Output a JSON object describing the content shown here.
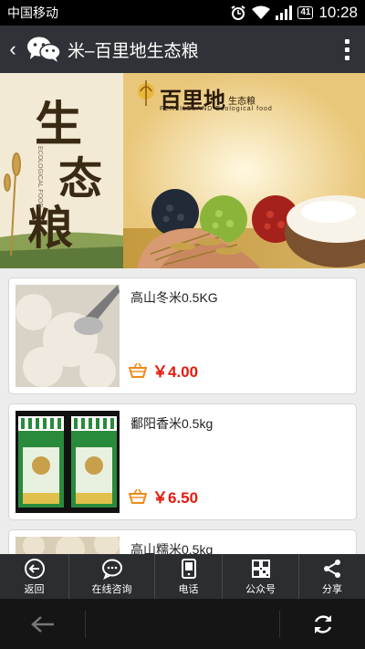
{
  "status_bar": {
    "carrier": "中国移动",
    "battery": "41",
    "time": "10:28"
  },
  "header": {
    "title": "米–百里地生态粮"
  },
  "banner": {
    "brand": "百里地",
    "brand_sub": "生态粮",
    "brand_en": "FERTILELAND Ecological food",
    "calligraphy": [
      "生",
      "态",
      "粮"
    ],
    "vertical_text": "ECOLOGICAL FOOD"
  },
  "products": [
    {
      "name": "高山冬米0.5KG",
      "price": "￥4.00"
    },
    {
      "name": "鄱阳香米0.5kg",
      "price": "￥6.50"
    },
    {
      "name": "高山糯米0.5kg",
      "price": ""
    }
  ],
  "menu": [
    {
      "label": "返回",
      "icon": "back-circle-icon"
    },
    {
      "label": "在线咨询",
      "icon": "chat-bubble-icon"
    },
    {
      "label": "电话",
      "icon": "phone-icon"
    },
    {
      "label": "公众号",
      "icon": "qrcode-icon"
    },
    {
      "label": "分享",
      "icon": "share-icon"
    }
  ],
  "colors": {
    "price": "#e21b0f",
    "title_bar": "#2f3236",
    "menu_bg": "#2b2d30"
  }
}
